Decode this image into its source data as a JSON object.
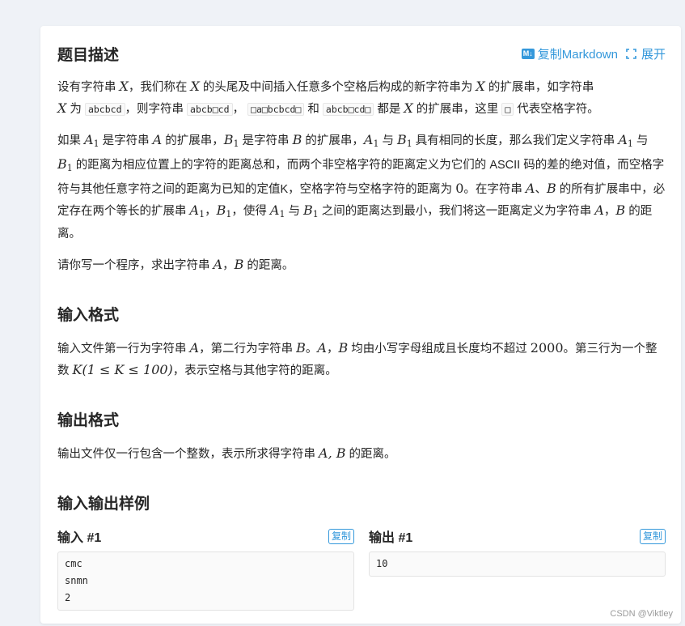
{
  "problem": {
    "title": "题目描述",
    "copy_markdown_label": "复制Markdown",
    "expand_label": "展开",
    "md_badge": "M↓",
    "desc_p1": {
      "t1": "设有字符串 ",
      "X": "X",
      "t2": "，我们称在 ",
      "t3": " 的头尾及中间插入任意多个空格后构成的新字符串为 ",
      "t4": " 的扩展串，如字符串 ",
      "t5": " 为 ",
      "code1": "abcbcd",
      "t6": "，则字符串 ",
      "code2": "abcb□cd",
      "t7": "，",
      "code3": "□a□bcbcd□",
      "t8": " 和 ",
      "code4": "abcb□cd□",
      "t9": " 都是 ",
      "t10": " 的扩展串，这里 ",
      "code5": "□",
      "t11": " 代表空格字符。"
    },
    "desc_p2": {
      "A": "A",
      "B": "B",
      "sub1": "1",
      "t1": "如果 ",
      "t2": " 是字符串 ",
      "t3": " 的扩展串，",
      "t4": " 是字符串 ",
      "t5": " 的扩展串，",
      "t6": " 与 ",
      "t7": " 具有相同的长度，那么我们定义字符串 ",
      "t8": " 与 ",
      "t9": " 的距离为相应位置上的字符的距离总和，而两个非空格字符的距离定义为它们的 ASCII 码的差的绝对值，而空格字符与其他任意字符之间的距离为已知的定值K，空格字符与空格字符的距离为 ",
      "zero": "0",
      "t10": "。在字符串 ",
      "t11": "、",
      "t12": " 的所有扩展串中，必定存在两个等长的扩展串 ",
      "t13": "，",
      "t14": "，使得 ",
      "t15": " 与 ",
      "t16": " 之间的距离达到最小，我们将这一距离定义为字符串 ",
      "t17": "，",
      "t18": " 的距离。"
    },
    "desc_p3": {
      "t1": "请你写一个程序，求出字符串 ",
      "t2": "，",
      "t3": " 的距离。"
    },
    "input_title": "输入格式",
    "input_desc": {
      "t1": "输入文件第一行为字符串 ",
      "t2": "，第二行为字符串 ",
      "t3": "。",
      "t4": "，",
      "t5": " 均由小写字母组成且长度均不超过 ",
      "n2000": "2000",
      "t6": "。第三行为一个整数 ",
      "k_expr": "K(1 ≤ K ≤ 100)",
      "t7": "，表示空格与其他字符的距离。"
    },
    "output_title": "输出格式",
    "output_desc": {
      "t1": "输出文件仅一行包含一个整数，表示所求得字符串 ",
      "ab": "A, B",
      "t2": " 的距离。"
    },
    "samples_title": "输入输出样例",
    "samples": [
      {
        "input_label": "输入 #1",
        "input_copy": "复制",
        "input_lines": [
          "cmc",
          "snmn",
          "2"
        ],
        "output_label": "输出 #1",
        "output_copy": "复制",
        "output_lines": [
          "10"
        ]
      }
    ]
  },
  "watermark": "CSDN @Viktley",
  "colors": {
    "accent": "#3498db",
    "text": "#262626",
    "background": "#eff2f7"
  }
}
